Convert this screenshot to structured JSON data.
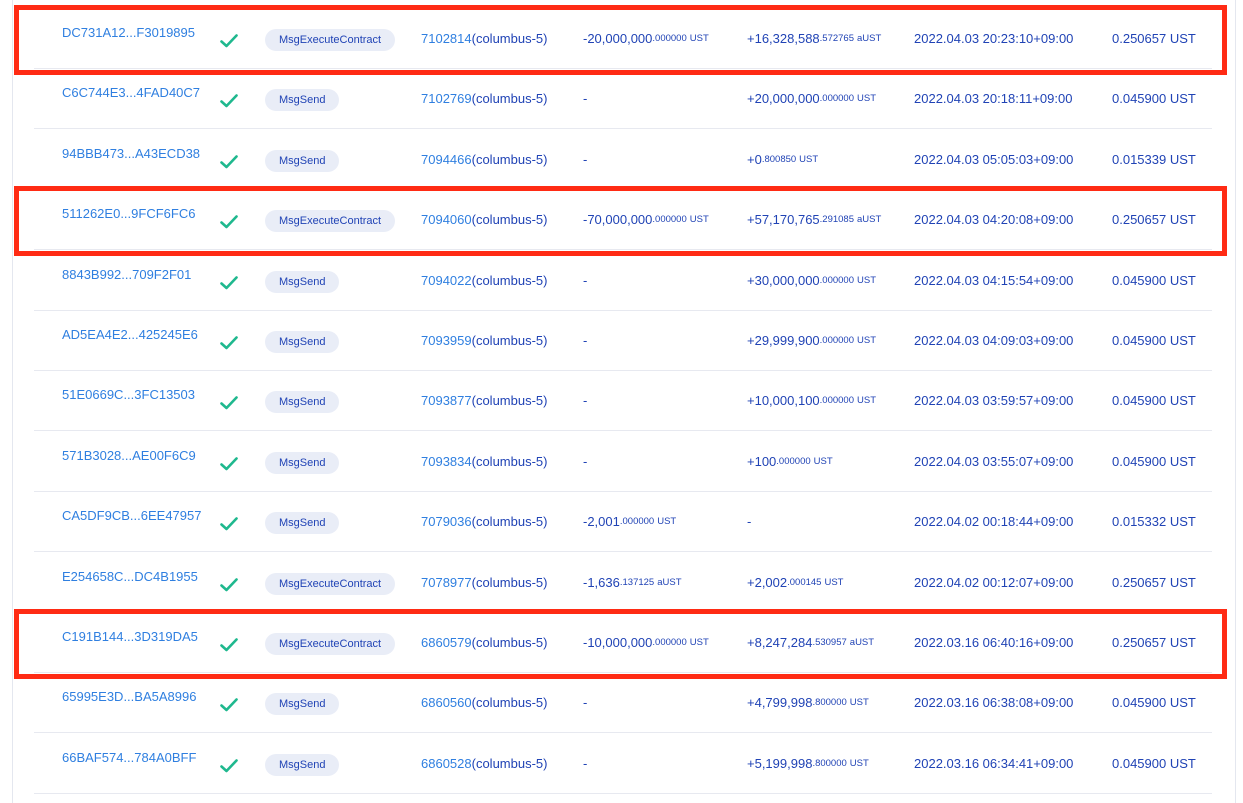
{
  "accent_color": "#ff2b14",
  "icons": {
    "status": "check-icon"
  },
  "transactions": [
    {
      "hash": "DC731A12...F3019895",
      "type": "MsgExecuteContract",
      "block_num": "7102814",
      "block_chain": "(columbus-5)",
      "out_main": "-20,000,000",
      "out_dec": ".000000",
      "out_unit": "UST",
      "in_main": "+16,328,588",
      "in_dec": ".572765",
      "in_unit": "aUST",
      "time": "2022.04.03 20:23:10+09:00",
      "fee": "0.250657 UST",
      "highlighted": true
    },
    {
      "hash": "C6C744E3...4FAD40C7",
      "type": "MsgSend",
      "block_num": "7102769",
      "block_chain": "(columbus-5)",
      "out_main": "-",
      "out_dec": "",
      "out_unit": "",
      "in_main": "+20,000,000",
      "in_dec": ".000000",
      "in_unit": "UST",
      "time": "2022.04.03 20:18:11+09:00",
      "fee": "0.045900 UST",
      "highlighted": false
    },
    {
      "hash": "94BBB473...A43ECD38",
      "type": "MsgSend",
      "block_num": "7094466",
      "block_chain": "(columbus-5)",
      "out_main": "-",
      "out_dec": "",
      "out_unit": "",
      "in_main": "+0",
      "in_dec": ".800850",
      "in_unit": "UST",
      "time": "2022.04.03 05:05:03+09:00",
      "fee": "0.015339 UST",
      "highlighted": false
    },
    {
      "hash": "511262E0...9FCF6FC6",
      "type": "MsgExecuteContract",
      "block_num": "7094060",
      "block_chain": "(columbus-5)",
      "out_main": "-70,000,000",
      "out_dec": ".000000",
      "out_unit": "UST",
      "in_main": "+57,170,765",
      "in_dec": ".291085",
      "in_unit": "aUST",
      "time": "2022.04.03 04:20:08+09:00",
      "fee": "0.250657 UST",
      "highlighted": true
    },
    {
      "hash": "8843B992...709F2F01",
      "type": "MsgSend",
      "block_num": "7094022",
      "block_chain": "(columbus-5)",
      "out_main": "-",
      "out_dec": "",
      "out_unit": "",
      "in_main": "+30,000,000",
      "in_dec": ".000000",
      "in_unit": "UST",
      "time": "2022.04.03 04:15:54+09:00",
      "fee": "0.045900 UST",
      "highlighted": false
    },
    {
      "hash": "AD5EA4E2...425245E6",
      "type": "MsgSend",
      "block_num": "7093959",
      "block_chain": "(columbus-5)",
      "out_main": "-",
      "out_dec": "",
      "out_unit": "",
      "in_main": "+29,999,900",
      "in_dec": ".000000",
      "in_unit": "UST",
      "time": "2022.04.03 04:09:03+09:00",
      "fee": "0.045900 UST",
      "highlighted": false
    },
    {
      "hash": "51E0669C...3FC13503",
      "type": "MsgSend",
      "block_num": "7093877",
      "block_chain": "(columbus-5)",
      "out_main": "-",
      "out_dec": "",
      "out_unit": "",
      "in_main": "+10,000,100",
      "in_dec": ".000000",
      "in_unit": "UST",
      "time": "2022.04.03 03:59:57+09:00",
      "fee": "0.045900 UST",
      "highlighted": false
    },
    {
      "hash": "571B3028...AE00F6C9",
      "type": "MsgSend",
      "block_num": "7093834",
      "block_chain": "(columbus-5)",
      "out_main": "-",
      "out_dec": "",
      "out_unit": "",
      "in_main": "+100",
      "in_dec": ".000000",
      "in_unit": "UST",
      "time": "2022.04.03 03:55:07+09:00",
      "fee": "0.045900 UST",
      "highlighted": false
    },
    {
      "hash": "CA5DF9CB...6EE47957",
      "type": "MsgSend",
      "block_num": "7079036",
      "block_chain": "(columbus-5)",
      "out_main": "-2,001",
      "out_dec": ".000000",
      "out_unit": "UST",
      "in_main": "-",
      "in_dec": "",
      "in_unit": "",
      "time": "2022.04.02 00:18:44+09:00",
      "fee": "0.015332 UST",
      "highlighted": false
    },
    {
      "hash": "E254658C...DC4B1955",
      "type": "MsgExecuteContract",
      "block_num": "7078977",
      "block_chain": "(columbus-5)",
      "out_main": "-1,636",
      "out_dec": ".137125",
      "out_unit": "aUST",
      "in_main": "+2,002",
      "in_dec": ".000145",
      "in_unit": "UST",
      "time": "2022.04.02 00:12:07+09:00",
      "fee": "0.250657 UST",
      "highlighted": false
    },
    {
      "hash": "C191B144...3D319DA5",
      "type": "MsgExecuteContract",
      "block_num": "6860579",
      "block_chain": "(columbus-5)",
      "out_main": "-10,000,000",
      "out_dec": ".000000",
      "out_unit": "UST",
      "in_main": "+8,247,284",
      "in_dec": ".530957",
      "in_unit": "aUST",
      "time": "2022.03.16 06:40:16+09:00",
      "fee": "0.250657 UST",
      "highlighted": true
    },
    {
      "hash": "65995E3D...BA5A8996",
      "type": "MsgSend",
      "block_num": "6860560",
      "block_chain": "(columbus-5)",
      "out_main": "-",
      "out_dec": "",
      "out_unit": "",
      "in_main": "+4,799,998",
      "in_dec": ".800000",
      "in_unit": "UST",
      "time": "2022.03.16 06:38:08+09:00",
      "fee": "0.045900 UST",
      "highlighted": false
    },
    {
      "hash": "66BAF574...784A0BFF",
      "type": "MsgSend",
      "block_num": "6860528",
      "block_chain": "(columbus-5)",
      "out_main": "-",
      "out_dec": "",
      "out_unit": "",
      "in_main": "+5,199,998",
      "in_dec": ".800000",
      "in_unit": "UST",
      "time": "2022.03.16 06:34:41+09:00",
      "fee": "0.045900 UST",
      "highlighted": false
    }
  ]
}
